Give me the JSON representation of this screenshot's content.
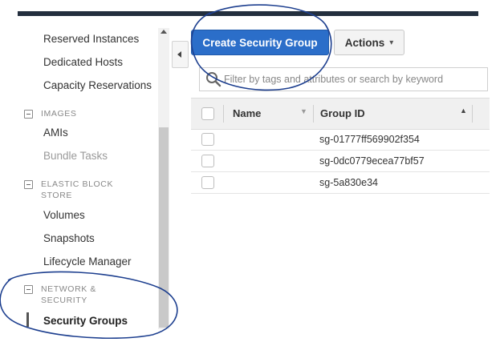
{
  "sidebar": {
    "items_top": [
      {
        "label": "Reserved Instances"
      },
      {
        "label": "Dedicated Hosts"
      },
      {
        "label": "Capacity Reservations"
      }
    ],
    "sections": [
      {
        "title": "IMAGES",
        "items": [
          {
            "label": "AMIs"
          },
          {
            "label": "Bundle Tasks"
          }
        ]
      },
      {
        "title": "ELASTIC BLOCK STORE",
        "items": [
          {
            "label": "Volumes"
          },
          {
            "label": "Snapshots"
          },
          {
            "label": "Lifecycle Manager"
          }
        ]
      },
      {
        "title": "NETWORK & SECURITY",
        "items": [
          {
            "label": "Security Groups"
          }
        ]
      }
    ]
  },
  "toolbar": {
    "create_label": "Create Security Group",
    "actions_label": "Actions",
    "actions_chevron": "▾"
  },
  "search": {
    "placeholder": "Filter by tags and attributes or search by keyword"
  },
  "table": {
    "columns": [
      "Name",
      "Group ID"
    ],
    "name_sort_glyph": "▼",
    "gid_sort_glyph": "▲",
    "rows": [
      {
        "name": "",
        "group_id": "sg-01777ff569902f354"
      },
      {
        "name": "",
        "group_id": "sg-0dc0779ecea77bf57"
      },
      {
        "name": "",
        "group_id": "sg-5a830e34"
      }
    ]
  },
  "colors": {
    "primary": "#2b6ec9",
    "annotation": "#1d3f8f",
    "topbar": "#232f3e"
  },
  "icons": [
    "search-icon",
    "collapse-left-icon",
    "chevron-down-icon",
    "minus-toggle-icon"
  ]
}
